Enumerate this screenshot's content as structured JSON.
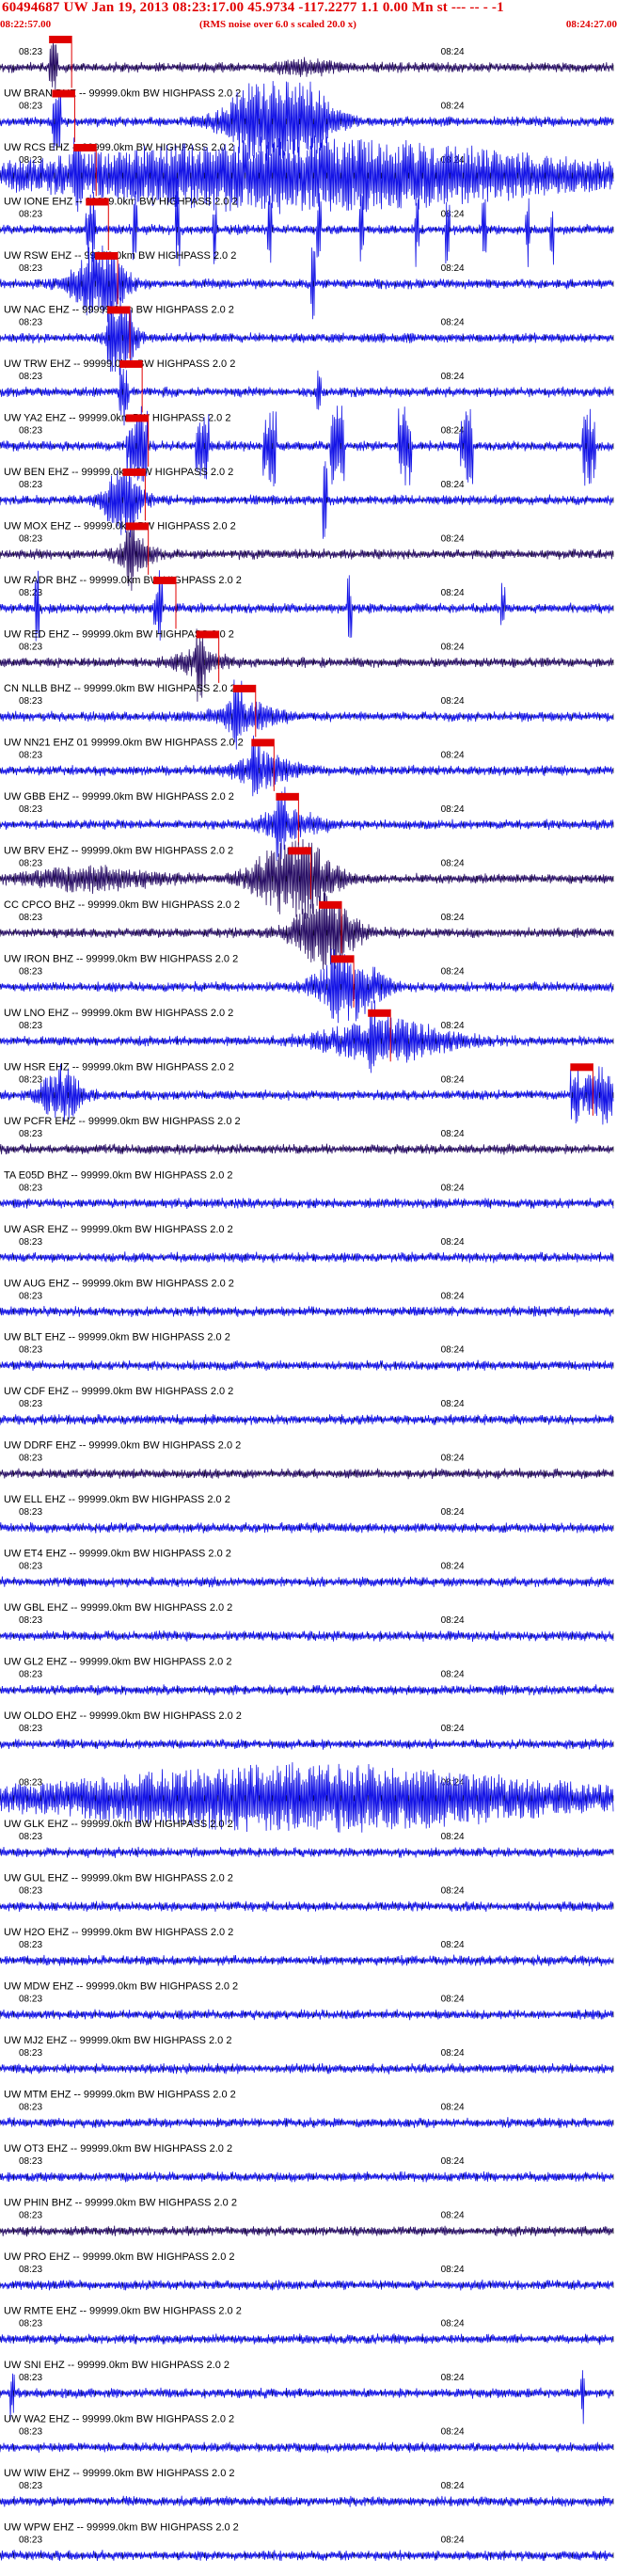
{
  "header": {
    "title": "60494687 UW Jan 19, 2013 08:23:17.00   45.9734 -117.2277  1.1 0.00 Mn st --- -- -  -1",
    "start_time": "08:22:57.00",
    "noise_note": "(RMS noise over 6.0 s scaled 20.0 x)",
    "end_time": "08:24:27.00"
  },
  "colors": {
    "trace_blue": "#1414e6",
    "trace_dark": "#2a1066",
    "pick_red": "#e00000",
    "text": "#000000"
  },
  "chart_data": {
    "type": "line",
    "x_range": [
      "08:22:57.00",
      "08:24:27.00"
    ],
    "time_tick_labels": [
      "08:23",
      "08:24"
    ],
    "grid": false,
    "traces": [
      {
        "label": "",
        "color": "dark",
        "pick": 0.08,
        "events": [
          [
            0.5,
            0.3,
            0.05
          ]
        ]
      },
      {
        "label": "UW BRAN BHZ -- 99999.0km BW  HIGHPASS  2.0  2",
        "color": "blue",
        "pick": 0.085,
        "events": [
          [
            0.43,
            2.2,
            0.06
          ],
          [
            0.5,
            1.4,
            0.05
          ]
        ]
      },
      {
        "label": "UW RCS EHZ -- 99999.0km BW  HIGHPASS  2.0  2",
        "color": "blue",
        "pick": 0.12,
        "events": [
          [
            0.5,
            1.8,
            0.45
          ]
        ]
      },
      {
        "label": "UW IONE EHZ -- 99999.0km BW  HIGHPASS  2.0  2",
        "color": "blue",
        "pick": 0.14,
        "spikes": [
          0.15,
          0.22,
          0.29,
          0.35,
          0.44,
          0.52,
          0.59,
          0.68,
          0.73,
          0.79,
          0.86,
          0.9
        ]
      },
      {
        "label": "UW RSW EHZ -- 99999.0km BW  HIGHPASS  2.0  2",
        "color": "blue",
        "pick": 0.155,
        "events": [
          [
            0.16,
            2.0,
            0.04
          ]
        ],
        "spikes": [
          0.51
        ]
      },
      {
        "label": "UW NAC EHZ -- 99999.0km BW  HIGHPASS  2.0  2",
        "color": "blue",
        "pick": 0.175,
        "events": [
          [
            0.2,
            1.9,
            0.02
          ]
        ]
      },
      {
        "label": "UW TRW EHZ -- 99999.0km BW  HIGHPASS  2.0  2",
        "color": "blue",
        "pick": 0.195,
        "spikes": [
          0.2,
          0.52
        ]
      },
      {
        "label": "UW YA2 EHZ -- 99999.0km BW  HIGHPASS  2.0  2",
        "color": "blue",
        "pick": 0.205,
        "blocks": [
          0.23,
          0.33,
          0.44,
          0.55,
          0.66,
          0.76,
          0.96
        ]
      },
      {
        "label": "UW BEN EHZ -- 99999.0km BW  HIGHPASS  2.0  2",
        "color": "blue",
        "pick": 0.2,
        "events": [
          [
            0.2,
            1.6,
            0.03
          ]
        ],
        "spikes": [
          0.53
        ]
      },
      {
        "label": "UW MOX EHZ -- 99999.0km BW  HIGHPASS  2.0  2",
        "color": "dark",
        "pick": 0.205,
        "events": [
          [
            0.22,
            0.8,
            0.03
          ]
        ]
      },
      {
        "label": "UW RADR BHZ -- 99999.0km BW  HIGHPASS  2.0  2",
        "color": "blue",
        "pick": 0.25,
        "spikes": [
          0.06,
          0.26,
          0.57,
          0.82
        ]
      },
      {
        "label": "UW RED EHZ -- 99999.0km BW  HIGHPASS  2.0  2",
        "color": "dark",
        "pick": 0.32,
        "events": [
          [
            0.32,
            0.6,
            0.04
          ]
        ]
      },
      {
        "label": "CN NLLB BHZ -- 99999.0km BW  HIGHPASS  2.0  2",
        "color": "blue",
        "pick": 0.38,
        "events": [
          [
            0.4,
            0.7,
            0.05
          ]
        ]
      },
      {
        "label": "UW NN21 EHZ 01 99999.0km BW  HIGHPASS  2.0  2",
        "color": "blue",
        "pick": 0.41,
        "events": [
          [
            0.43,
            0.8,
            0.05
          ]
        ]
      },
      {
        "label": "UW GBB EHZ -- 99999.0km BW  HIGHPASS  2.0  2",
        "color": "blue",
        "pick": 0.45,
        "events": [
          [
            0.47,
            0.7,
            0.05
          ]
        ]
      },
      {
        "label": "UW BRV EHZ -- 99999.0km BW  HIGHPASS  2.0  2",
        "color": "dark",
        "pick": 0.47,
        "events": [
          [
            0.48,
            2.2,
            0.06
          ],
          [
            0.15,
            0.5,
            0.1
          ]
        ]
      },
      {
        "label": "CC CPCO BHZ -- 99999.0km BW  HIGHPASS  2.0  2",
        "color": "dark",
        "pick": 0.52,
        "events": [
          [
            0.53,
            1.8,
            0.05
          ]
        ]
      },
      {
        "label": "UW IRON BHZ -- 99999.0km BW  HIGHPASS  2.0  2",
        "color": "blue",
        "pick": 0.54,
        "events": [
          [
            0.57,
            1.6,
            0.05
          ]
        ]
      },
      {
        "label": "UW LNO EHZ -- 99999.0km BW  HIGHPASS  2.0  2",
        "color": "blue",
        "pick": 0.6,
        "events": [
          [
            0.63,
            1.0,
            0.1
          ]
        ]
      },
      {
        "label": "UW HSR EHZ -- 99999.0km BW  HIGHPASS  2.0  2",
        "color": "blue",
        "pick": 0.93,
        "events": [
          [
            0.1,
            1.4,
            0.03
          ],
          [
            0.98,
            1.4,
            0.03
          ]
        ]
      },
      {
        "label": "UW PCFR EHZ -- 99999.0km BW  HIGHPASS  2.0  2",
        "color": "dark",
        "pick": null
      },
      {
        "label": "TA E05D BHZ -- 99999.0km BW  HIGHPASS  2.0  2",
        "color": "blue",
        "pick": null
      },
      {
        "label": "UW ASR EHZ -- 99999.0km BW  HIGHPASS  2.0  2",
        "color": "blue",
        "pick": null
      },
      {
        "label": "UW AUG EHZ -- 99999.0km BW  HIGHPASS  2.0  2",
        "color": "blue",
        "pick": null
      },
      {
        "label": "UW BLT EHZ -- 99999.0km BW  HIGHPASS  2.0  2",
        "color": "blue",
        "pick": null
      },
      {
        "label": "UW CDF EHZ -- 99999.0km BW  HIGHPASS  2.0  2",
        "color": "blue",
        "pick": null
      },
      {
        "label": "UW DDRF EHZ -- 99999.0km BW  HIGHPASS  2.0  2",
        "color": "dark",
        "pick": null
      },
      {
        "label": "UW ELL EHZ -- 99999.0km BW  HIGHPASS  2.0  2",
        "color": "blue",
        "pick": null
      },
      {
        "label": "UW ET4 EHZ -- 99999.0km BW  HIGHPASS  2.0  2",
        "color": "blue",
        "pick": null
      },
      {
        "label": "UW GBL EHZ -- 99999.0km BW  HIGHPASS  2.0  2",
        "color": "blue",
        "pick": null
      },
      {
        "label": "UW GL2 EHZ -- 99999.0km BW  HIGHPASS  2.0  2",
        "color": "blue",
        "pick": null
      },
      {
        "label": "UW OLDO EHZ -- 99999.0km BW  HIGHPASS  2.0  2",
        "color": "blue",
        "pick": null
      },
      {
        "label": "",
        "color": "blue",
        "pick": null,
        "events": [
          [
            0.5,
            1.6,
            0.45
          ]
        ]
      },
      {
        "label": "UW GLK EHZ -- 99999.0km BW  HIGHPASS  2.0  2",
        "color": "blue",
        "pick": null
      },
      {
        "label": "UW GUL EHZ -- 99999.0km BW  HIGHPASS  2.0  2",
        "color": "blue",
        "pick": null
      },
      {
        "label": "UW H2O EHZ -- 99999.0km BW  HIGHPASS  2.0  2",
        "color": "blue",
        "pick": null
      },
      {
        "label": "UW MDW EHZ -- 99999.0km BW  HIGHPASS  2.0  2",
        "color": "blue",
        "pick": null
      },
      {
        "label": "UW MJ2 EHZ -- 99999.0km BW  HIGHPASS  2.0  2",
        "color": "blue",
        "pick": null
      },
      {
        "label": "UW MTM EHZ -- 99999.0km BW  HIGHPASS  2.0  2",
        "color": "blue",
        "pick": null
      },
      {
        "label": "UW OT3 EHZ -- 99999.0km BW  HIGHPASS  2.0  2",
        "color": "blue",
        "pick": null
      },
      {
        "label": "UW PHIN BHZ -- 99999.0km BW  HIGHPASS  2.0  2",
        "color": "dark",
        "pick": null
      },
      {
        "label": "UW PRO EHZ -- 99999.0km BW  HIGHPASS  2.0  2",
        "color": "blue",
        "pick": null
      },
      {
        "label": "UW RMTE EHZ -- 99999.0km BW  HIGHPASS  2.0  2",
        "color": "blue",
        "pick": null
      },
      {
        "label": "UW SNI EHZ -- 99999.0km BW  HIGHPASS  2.0  2",
        "color": "blue",
        "pick": null,
        "spikes": [
          0.02,
          0.95
        ]
      },
      {
        "label": "UW WA2 EHZ -- 99999.0km BW  HIGHPASS  2.0  2",
        "color": "blue",
        "pick": null
      },
      {
        "label": "UW WIW EHZ -- 99999.0km BW  HIGHPASS  2.0  2",
        "color": "blue",
        "pick": null
      },
      {
        "label": "UW WPW EHZ -- 99999.0km BW  HIGHPASS  2.0  2",
        "color": "blue",
        "pick": null
      }
    ]
  }
}
